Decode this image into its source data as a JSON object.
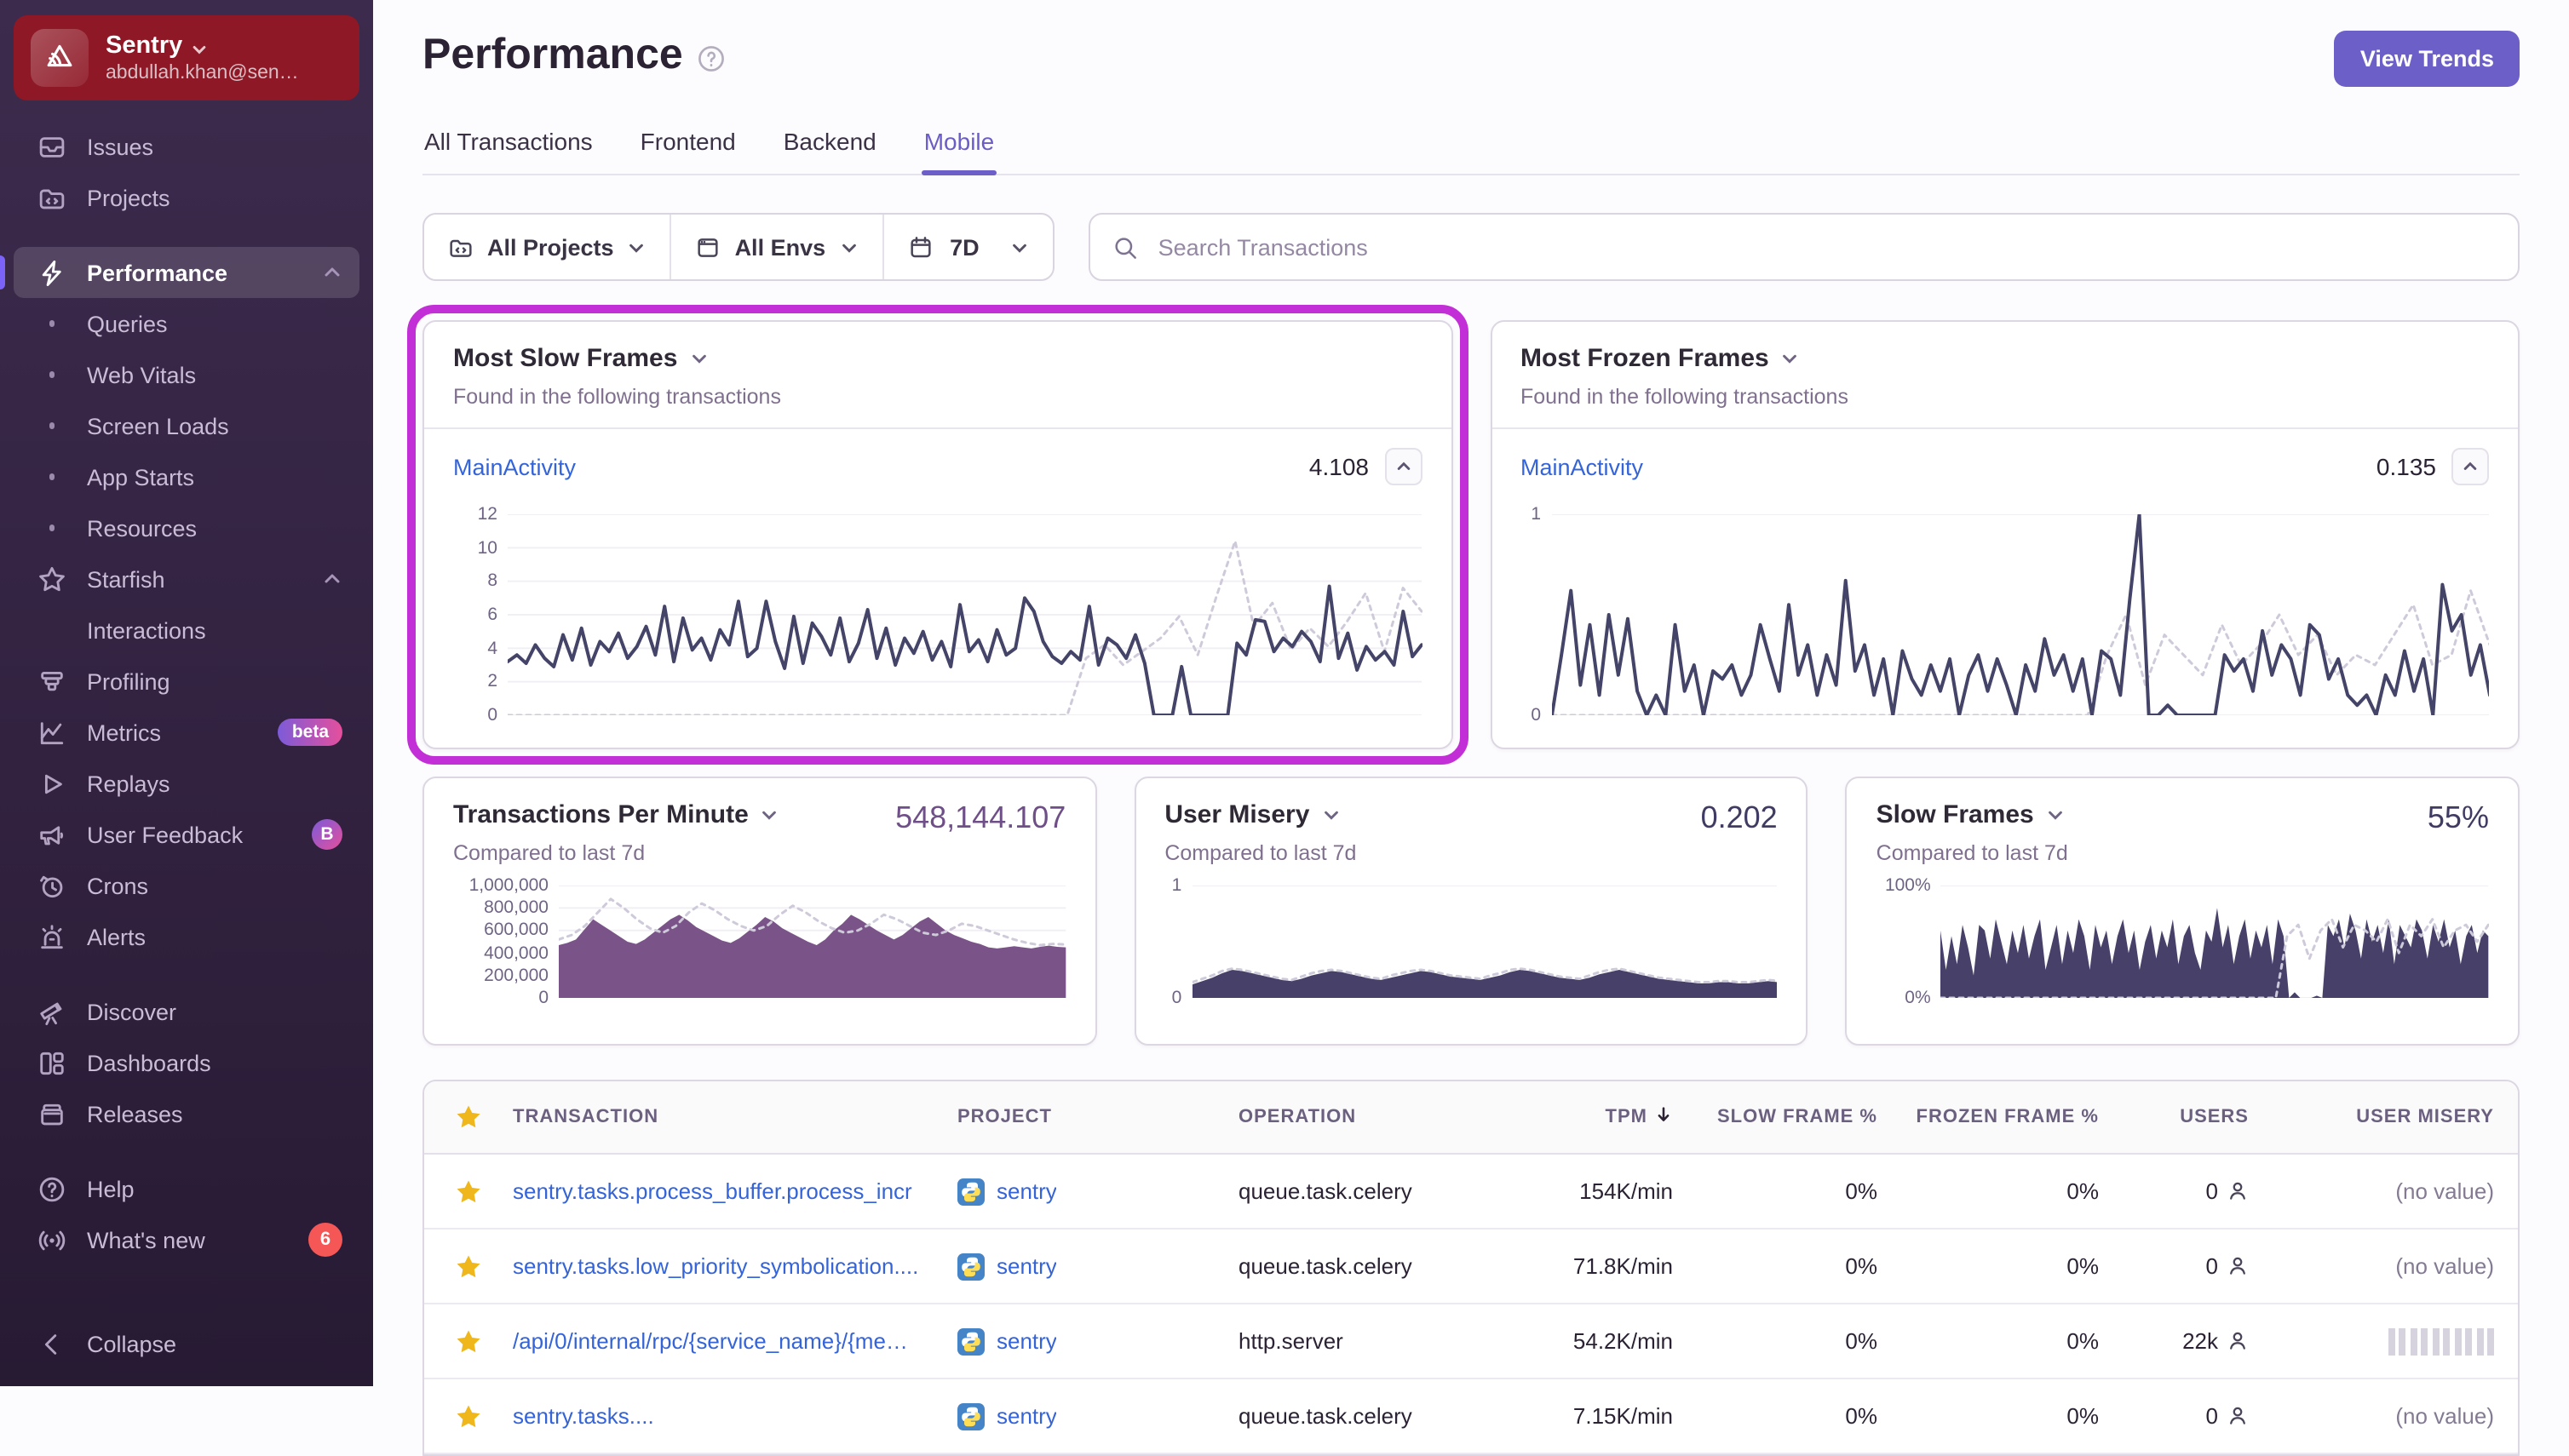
{
  "sidebar": {
    "org": {
      "name": "Sentry",
      "email": "abdullah.khan@sen…"
    },
    "sections": [
      [
        {
          "label": "Issues",
          "icon": "issues"
        },
        {
          "label": "Projects",
          "icon": "projects"
        }
      ],
      [
        {
          "label": "Performance",
          "icon": "performance",
          "selected": true,
          "chevron": "up"
        },
        {
          "label": "Queries",
          "sub": true
        },
        {
          "label": "Web Vitals",
          "sub": true
        },
        {
          "label": "Screen Loads",
          "sub": true
        },
        {
          "label": "App Starts",
          "sub": true
        },
        {
          "label": "Resources",
          "sub": true
        },
        {
          "label": "Starfish",
          "icon": "star",
          "chevron": "up"
        },
        {
          "label": "Interactions",
          "sub": true,
          "nobullet": true
        },
        {
          "label": "Profiling",
          "icon": "profiling"
        },
        {
          "label": "Metrics",
          "icon": "metrics",
          "badge": {
            "text": "beta",
            "style": "pill"
          }
        },
        {
          "label": "Replays",
          "icon": "replays"
        },
        {
          "label": "User Feedback",
          "icon": "user-feedback",
          "badge": {
            "text": "B",
            "style": "circle"
          }
        },
        {
          "label": "Crons",
          "icon": "crons"
        },
        {
          "label": "Alerts",
          "icon": "alerts"
        }
      ],
      [
        {
          "label": "Discover",
          "icon": "discover"
        },
        {
          "label": "Dashboards",
          "icon": "dashboards"
        },
        {
          "label": "Releases",
          "icon": "releases"
        }
      ],
      [
        {
          "label": "Help",
          "icon": "help"
        },
        {
          "label": "What's new",
          "icon": "whats-new",
          "badge": {
            "text": "6",
            "style": "count"
          }
        }
      ]
    ],
    "collapse_label": "Collapse"
  },
  "header": {
    "title": "Performance",
    "view_trends_label": "View Trends",
    "tabs": [
      {
        "label": "All Transactions"
      },
      {
        "label": "Frontend"
      },
      {
        "label": "Backend"
      },
      {
        "label": "Mobile",
        "active": true
      }
    ]
  },
  "filters": {
    "projects": "All Projects",
    "envs": "All Envs",
    "date": "7D",
    "search_placeholder": "Search Transactions"
  },
  "cards": {
    "most_slow_frames": {
      "title": "Most Slow Frames",
      "subtitle": "Found in the following transactions",
      "transaction": "MainActivity",
      "value": "4.108"
    },
    "most_frozen_frames": {
      "title": "Most Frozen Frames",
      "subtitle": "Found in the following transactions",
      "transaction": "MainActivity",
      "value": "0.135"
    },
    "tpm": {
      "title": "Transactions Per Minute",
      "subtitle": "Compared to last 7d",
      "value": "548,144.107",
      "value_color": "#6f4f87"
    },
    "user_misery": {
      "title": "User Misery",
      "subtitle": "Compared to last 7d",
      "value": "0.202",
      "value_color": "#3f3b63"
    },
    "slow_frames": {
      "title": "Slow Frames",
      "subtitle": "Compared to last 7d",
      "value": "55%",
      "value_color": "#3f3b63"
    }
  },
  "chart_data": {
    "most_slow_frames": {
      "type": "line",
      "title": "Most Slow Frames - MainActivity",
      "ylim": [
        0,
        12
      ],
      "grid": true,
      "legend": "none",
      "ticks": [
        "12",
        "10",
        "8",
        "6",
        "4",
        "2",
        "0"
      ],
      "label_w": 32,
      "height": 118,
      "series": [
        {
          "name": "previous period",
          "kind": "line",
          "color": "#cfcada",
          "width": 1.5,
          "dash": true,
          "values": [
            0,
            0,
            0,
            0,
            0,
            0,
            0,
            0,
            0,
            0,
            0,
            0,
            0,
            0,
            0,
            0,
            0,
            0,
            0,
            0,
            0,
            0,
            0,
            0,
            0,
            0,
            0,
            0,
            0,
            0,
            0,
            3.4,
            4.2,
            3.0,
            3.8,
            4.6,
            5.9,
            3.6,
            7.1,
            10.4,
            5.3,
            6.7,
            3.9,
            5.2,
            4.1,
            5.6,
            7.3,
            3.8,
            7.6,
            6.2
          ]
        },
        {
          "name": "current period",
          "kind": "line",
          "color": "#444368",
          "width": 2,
          "values": [
            3.2,
            3.6,
            3.1,
            4.2,
            3.4,
            2.9,
            4.8,
            3.3,
            5.2,
            3.0,
            4.4,
            3.8,
            4.9,
            3.4,
            4.1,
            5.3,
            3.6,
            6.5,
            3.2,
            5.8,
            3.9,
            4.6,
            3.3,
            5.1,
            4.2,
            6.8,
            3.5,
            4.0,
            6.8,
            4.4,
            2.8,
            5.9,
            3.1,
            5.5,
            4.7,
            3.6,
            5.8,
            3.2,
            4.3,
            6.3,
            3.4,
            5.2,
            3.0,
            4.6,
            3.7,
            5.0,
            3.3,
            4.4,
            2.9,
            6.6,
            3.8,
            4.5,
            3.2,
            5.1,
            3.6,
            4.0,
            7.0,
            6.2,
            4.4,
            3.5,
            3.1,
            3.8,
            3.3,
            6.5,
            3.0,
            4.6,
            4.2,
            3.4,
            4.8,
            3.1,
            0,
            0,
            0,
            2.9,
            0,
            0,
            0,
            0,
            0,
            4.3,
            3.6,
            5.7,
            5.6,
            3.8,
            4.6,
            4.1,
            5.0,
            4.4,
            3.2,
            7.7,
            3.4,
            4.9,
            2.7,
            4.1,
            3.3,
            3.8,
            3.0,
            6.2,
            3.5,
            4.2
          ]
        }
      ]
    },
    "most_frozen_frames": {
      "type": "line",
      "title": "Most Frozen Frames - MainActivity",
      "ylim": [
        0,
        1
      ],
      "grid": true,
      "legend": "none",
      "ticks": [
        "1",
        "0"
      ],
      "label_w": 18,
      "height": 118,
      "series": [
        {
          "name": "previous period",
          "kind": "line",
          "color": "#cfcada",
          "width": 1.5,
          "dash": true,
          "values": [
            0,
            0,
            0,
            0,
            0,
            0,
            0,
            0,
            0,
            0,
            0,
            0,
            0,
            0,
            0,
            0,
            0,
            0,
            0,
            0,
            0,
            0,
            0,
            0,
            0,
            0,
            0,
            0,
            0,
            0.3,
            0.5,
            0.15,
            0.4,
            0.3,
            0.2,
            0.45,
            0.25,
            0.35,
            0.5,
            0.3,
            0.4,
            0.2,
            0.3,
            0.25,
            0.4,
            0.55,
            0.25,
            0.3,
            0.62,
            0.35
          ]
        },
        {
          "name": "current period",
          "kind": "line",
          "color": "#444368",
          "width": 2,
          "values": [
            0,
            0.3,
            0.62,
            0.15,
            0.45,
            0.1,
            0.5,
            0.2,
            0.48,
            0.12,
            0,
            0.1,
            0,
            0.45,
            0.12,
            0.25,
            0,
            0.22,
            0.18,
            0.25,
            0.1,
            0.2,
            0.45,
            0.28,
            0.12,
            0.55,
            0.2,
            0.35,
            0.1,
            0.3,
            0.15,
            0.67,
            0.22,
            0.35,
            0.1,
            0.28,
            0,
            0.32,
            0.18,
            0.1,
            0.25,
            0.12,
            0.28,
            0,
            0.2,
            0.3,
            0.12,
            0.28,
            0.15,
            0,
            0.25,
            0.12,
            0.38,
            0.2,
            0.3,
            0.12,
            0.28,
            0,
            0.32,
            0.28,
            0.1,
            0.58,
            1.0,
            0,
            0,
            0.05,
            0,
            0,
            0,
            0,
            0,
            0.3,
            0.22,
            0.28,
            0.12,
            0.42,
            0.2,
            0.35,
            0.28,
            0.1,
            0.45,
            0.4,
            0.18,
            0.28,
            0.1,
            0.05,
            0.1,
            0,
            0.2,
            0.1,
            0.32,
            0.12,
            0.28,
            0,
            0.65,
            0.42,
            0.5,
            0.2,
            0.35,
            0.1
          ]
        }
      ]
    },
    "tpm": {
      "type": "area",
      "title": "Transactions Per Minute",
      "ylim": [
        0,
        1000
      ],
      "grid": true,
      "legend": "none",
      "ticks": [
        "1,000,000",
        "800,000",
        "600,000",
        "400,000",
        "200,000",
        "0"
      ],
      "label_w": 62,
      "height": 66,
      "series": [
        {
          "name": "current period",
          "kind": "area",
          "color": "#7a5488",
          "values": [
            470,
            490,
            520,
            610,
            700,
            650,
            600,
            550,
            500,
            480,
            520,
            580,
            640,
            700,
            740,
            690,
            630,
            590,
            550,
            510,
            490,
            530,
            590,
            650,
            720,
            680,
            620,
            580,
            540,
            500,
            470,
            520,
            600,
            660,
            740,
            700,
            650,
            600,
            560,
            520,
            560,
            620,
            680,
            720,
            660,
            600,
            560,
            530,
            500,
            480,
            450,
            440,
            450,
            460,
            450,
            440,
            455,
            465,
            455,
            450
          ]
        },
        {
          "name": "previous period",
          "kind": "line",
          "color": "#cfcada",
          "width": 1.5,
          "dash": true,
          "values": [
            520,
            560,
            640,
            760,
            880,
            800,
            700,
            620,
            580,
            640,
            760,
            840,
            780,
            700,
            640,
            600,
            640,
            740,
            820,
            760,
            680,
            620,
            580,
            600,
            660,
            740,
            700,
            640,
            580,
            560,
            600,
            660,
            640,
            600,
            560,
            520,
            490,
            470,
            480,
            475
          ]
        }
      ]
    },
    "user_misery": {
      "type": "area",
      "title": "User Misery",
      "ylim": [
        0,
        1
      ],
      "grid": true,
      "legend": "none",
      "ticks": [
        "1",
        "0"
      ],
      "label_w": 16,
      "height": 66,
      "series": [
        {
          "name": "current period",
          "kind": "area",
          "color": "#474169",
          "values": [
            0.12,
            0.15,
            0.18,
            0.22,
            0.25,
            0.24,
            0.22,
            0.2,
            0.18,
            0.16,
            0.15,
            0.17,
            0.2,
            0.22,
            0.24,
            0.23,
            0.21,
            0.19,
            0.17,
            0.16,
            0.18,
            0.2,
            0.22,
            0.24,
            0.23,
            0.21,
            0.19,
            0.18,
            0.17,
            0.16,
            0.18,
            0.2,
            0.23,
            0.25,
            0.24,
            0.22,
            0.2,
            0.18,
            0.17,
            0.16,
            0.18,
            0.21,
            0.23,
            0.25,
            0.23,
            0.21,
            0.19,
            0.17,
            0.16,
            0.15,
            0.14,
            0.13,
            0.13,
            0.14,
            0.14,
            0.13,
            0.13,
            0.14,
            0.15,
            0.14
          ]
        },
        {
          "name": "previous period",
          "kind": "line",
          "color": "#cfcada",
          "width": 1.5,
          "dash": true,
          "values": [
            0.14,
            0.17,
            0.2,
            0.24,
            0.26,
            0.25,
            0.23,
            0.21,
            0.19,
            0.17,
            0.16,
            0.19,
            0.22,
            0.24,
            0.25,
            0.24,
            0.22,
            0.2,
            0.18,
            0.17,
            0.2,
            0.22,
            0.24,
            0.25,
            0.24,
            0.22,
            0.2,
            0.19,
            0.18,
            0.17,
            0.2,
            0.22,
            0.25,
            0.26,
            0.25,
            0.23,
            0.21,
            0.19,
            0.18,
            0.17,
            0.2,
            0.23,
            0.25,
            0.26,
            0.24,
            0.22,
            0.2,
            0.18,
            0.17,
            0.16,
            0.15,
            0.14,
            0.14,
            0.15,
            0.15,
            0.14,
            0.14,
            0.15,
            0.16,
            0.15
          ]
        }
      ]
    },
    "slow_frames_pct": {
      "type": "area",
      "title": "Slow Frames",
      "ylim": [
        0,
        100
      ],
      "grid": true,
      "legend": "none",
      "ticks": [
        "100%",
        "0%"
      ],
      "label_w": 38,
      "height": 66,
      "series": [
        {
          "name": "current period",
          "kind": "area",
          "color": "#474169",
          "values": [
            60,
            25,
            55,
            30,
            65,
            45,
            20,
            65,
            60,
            35,
            70,
            50,
            30,
            60,
            40,
            65,
            35,
            55,
            70,
            25,
            45,
            65,
            30,
            60,
            40,
            70,
            55,
            25,
            65,
            45,
            60,
            30,
            55,
            70,
            40,
            60,
            25,
            50,
            65,
            35,
            60,
            45,
            70,
            30,
            55,
            65,
            40,
            25,
            60,
            50,
            80,
            45,
            65,
            30,
            55,
            70,
            35,
            60,
            45,
            65,
            30,
            70,
            55,
            0,
            5,
            0,
            0,
            0,
            2,
            0,
            65,
            55,
            70,
            45,
            75,
            60,
            35,
            70,
            50,
            65,
            40,
            70,
            30,
            65,
            55,
            45,
            70,
            60,
            35,
            65,
            50,
            70,
            45,
            60,
            30,
            55,
            65,
            40,
            60,
            55
          ]
        },
        {
          "name": "previous period",
          "kind": "line",
          "color": "#cfcada",
          "width": 1.5,
          "dash": true,
          "values": [
            0,
            0,
            0,
            0,
            0,
            0,
            0,
            0,
            0,
            0,
            0,
            0,
            0,
            0,
            0,
            0,
            0,
            0,
            0,
            0,
            0,
            0,
            0,
            0,
            0,
            0,
            0,
            0,
            0,
            0,
            0,
            55,
            65,
            35,
            60,
            70,
            45,
            65,
            60,
            50,
            70,
            40,
            65,
            55,
            70,
            45,
            60,
            65,
            50,
            65
          ]
        }
      ]
    }
  },
  "table": {
    "columns": [
      "TRANSACTION",
      "PROJECT",
      "OPERATION",
      "TPM",
      "SLOW FRAME %",
      "FROZEN FRAME %",
      "USERS",
      "USER MISERY"
    ],
    "sorted_column": "TPM",
    "rows": [
      {
        "transaction": "sentry.tasks.process_buffer.process_incr",
        "project": "sentry",
        "operation": "queue.task.celery",
        "tpm": "154K/min",
        "slow": "0%",
        "frozen": "0%",
        "users": "0",
        "misery": "(no value)",
        "misery_type": "text"
      },
      {
        "transaction": "sentry.tasks.low_priority_symbolication....",
        "project": "sentry",
        "operation": "queue.task.celery",
        "tpm": "71.8K/min",
        "slow": "0%",
        "frozen": "0%",
        "users": "0",
        "misery": "(no value)",
        "misery_type": "text"
      },
      {
        "transaction": "/api/0/internal/rpc/{service_name}/{me…",
        "project": "sentry",
        "operation": "http.server",
        "tpm": "54.2K/min",
        "slow": "0%",
        "frozen": "0%",
        "users": "22k",
        "misery_type": "bars",
        "misery_bars": 10
      },
      {
        "transaction": "sentry.tasks....",
        "project": "sentry",
        "operation": "queue.task.celery",
        "tpm": "7.15K/min",
        "slow": "0%",
        "frozen": "0%",
        "users": "0",
        "misery": "(no value)",
        "misery_type": "text",
        "clipped": true
      }
    ]
  },
  "colors": {
    "accent": "#6c5fc7",
    "spotlight": "#c32fd6",
    "chart_line": "#444368",
    "chart_prev": "#cfcada",
    "tpm_fill": "#7a5488",
    "link": "#3464d8",
    "star": "#efb71c"
  }
}
